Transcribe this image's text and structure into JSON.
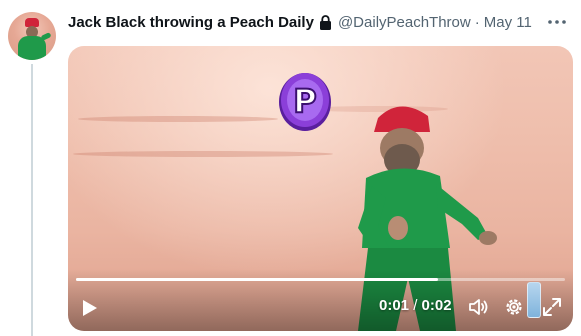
{
  "tweet": {
    "display_name": "Jack Black throwing a Peach Daily",
    "handle": "@DailyPeachThrow",
    "separator": "·",
    "date": "May 11",
    "icons": {
      "lock": "lock-icon",
      "more": "more-icon"
    }
  },
  "video": {
    "current_time": "0:01",
    "time_separator": " / ",
    "duration": "0:02",
    "progress_fraction": 0.74,
    "coin_letter": "P",
    "icons": {
      "play": "play-icon",
      "volume": "volume-icon",
      "settings": "gear-icon",
      "fullscreen": "expand-icon"
    },
    "colors": {
      "shirt": "#1f9a4a",
      "hat": "#d0243a",
      "coin": "#8b3fd9"
    }
  }
}
